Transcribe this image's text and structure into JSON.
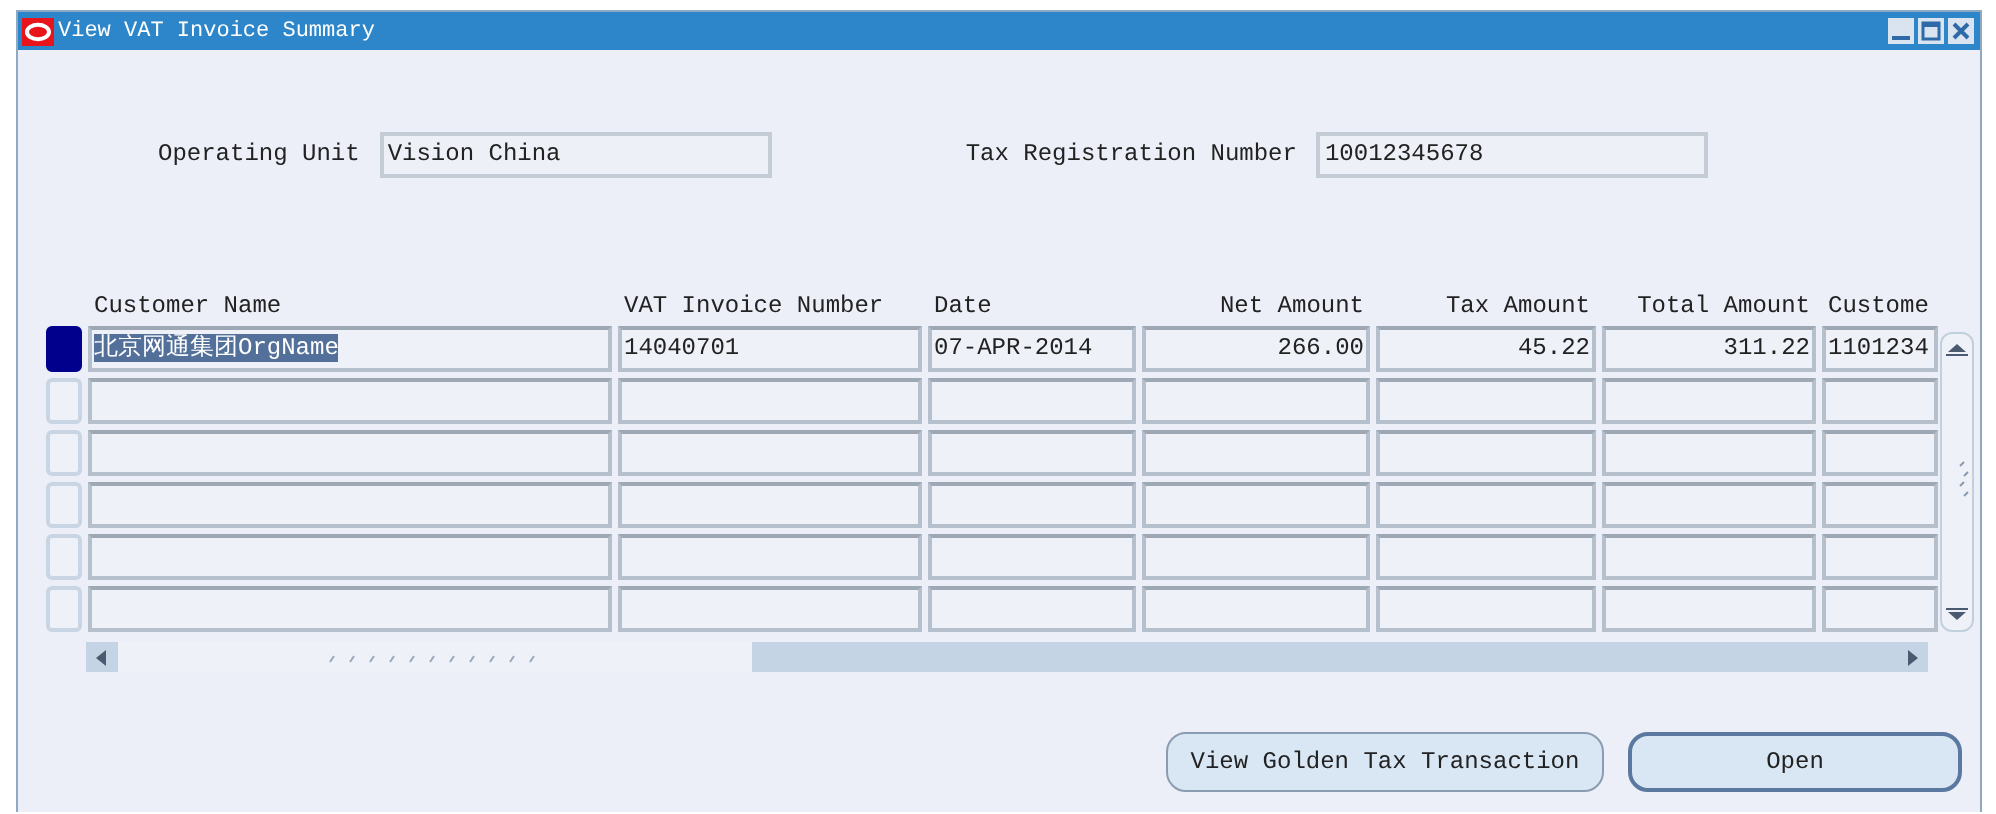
{
  "window": {
    "title": "View VAT Invoice Summary"
  },
  "header_fields": [
    {
      "label": "Operating Unit",
      "value": "Vision China"
    },
    {
      "label": "Tax Registration Number",
      "value": "10012345678"
    }
  ],
  "table": {
    "columns": [
      {
        "label": "Customer Name",
        "kind": "text"
      },
      {
        "label": "VAT Invoice Number",
        "kind": "text"
      },
      {
        "label": "Date",
        "kind": "text"
      },
      {
        "label": "Net Amount",
        "kind": "amount"
      },
      {
        "label": "Tax Amount",
        "kind": "amount"
      },
      {
        "label": "Total Amount",
        "kind": "amount"
      },
      {
        "label": "Custome",
        "kind": "text"
      }
    ],
    "rows": [
      {
        "selected": true,
        "cells": [
          "北京网通集团OrgName",
          "14040701",
          "07-APR-2014",
          "266.00",
          "45.22",
          "311.22",
          "1101234"
        ]
      },
      {
        "selected": false
      },
      {
        "selected": false
      },
      {
        "selected": false
      },
      {
        "selected": false
      },
      {
        "selected": false
      }
    ]
  },
  "buttons": [
    {
      "label": "View Golden Tax Transaction",
      "default": false
    },
    {
      "label": "Open",
      "default": true
    }
  ]
}
